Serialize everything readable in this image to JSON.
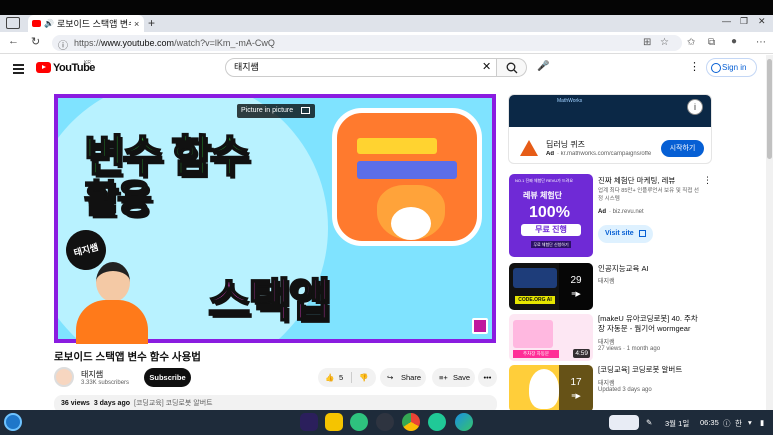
{
  "browser": {
    "tab_title": "로보이드 스택앱 변수 함",
    "tab_close": "×",
    "new_tab": "+",
    "url_prefix": "https://",
    "url_host": "www.youtube.com",
    "url_path": "/watch?v=lKm_-mA-CwQ",
    "win_min": "—",
    "win_max": "❐",
    "win_close": "✕"
  },
  "youtube": {
    "logo_text": "YouTube",
    "region": "KR",
    "search_value": "태지쌤",
    "sign_in": "Sign in"
  },
  "player": {
    "pip_label": "Picture in picture",
    "thumb_line1": "변수 함수",
    "thumb_line2": "활용",
    "thumb_line3": "스택앱",
    "thumb_badge": "태지쌤"
  },
  "video": {
    "title": "로보이드 스택앱 변수 함수 사용법",
    "channel": "태지쌤",
    "subscribers": "3.33K subscribers",
    "subscribe": "Subscribe",
    "likes": "5",
    "share": "Share",
    "save": "Save",
    "more": "•••",
    "views": "36 views",
    "date": "3 days ago",
    "tags": "[코딩교육] 코딩로봇 알버트"
  },
  "sidebar": {
    "ad1": {
      "banner": "MathWorks",
      "title": "딥러닝 퀴즈",
      "ad_label": "Ad",
      "url": "· kr.mathworks.com/campaigns/offe",
      "cta": "시작하기"
    },
    "ad2": {
      "img_top": "NO.1 진짜 체험단 REVU가 드려요",
      "img_head": "레뷰 체험단",
      "img_pct": "100%",
      "img_free": "무료 진행",
      "img_btn": "무료 체험단 신청하기",
      "title": "진짜 체험단 마케팅, 레뷰",
      "desc": "업계 최다 85만+ 인플루언서 보유 및 직접 선정 시스템",
      "ad_label": "Ad",
      "url": "· biz.revu.net",
      "cta": "Visit site"
    },
    "recs": [
      {
        "title": "인공지능교육 AI",
        "meta": "태지쌤",
        "meta2": "",
        "playlist_count": "29",
        "thumb_text": "CODE.ORG AI"
      },
      {
        "title": "[makeU 유아코딩로봇] 40. 주차장 자동문 - 웜기어 wormgear",
        "meta": "태지쌤",
        "meta2": "27 views · 1 month ago",
        "duration": "4:59",
        "thumb_text": "주차장 자동문"
      },
      {
        "title": "[코딩교육] 코딩로봇 알버트",
        "meta": "태지쌤",
        "meta2": "Updated 3 days ago",
        "playlist_count": "17"
      }
    ]
  },
  "shelf": {
    "date": "3월 1일",
    "time": "06:35",
    "lang": "한"
  },
  "colors": {
    "youtube_red": "#ff0000",
    "link_blue": "#065fd4",
    "thumb_purple": "#8a1ce0"
  }
}
